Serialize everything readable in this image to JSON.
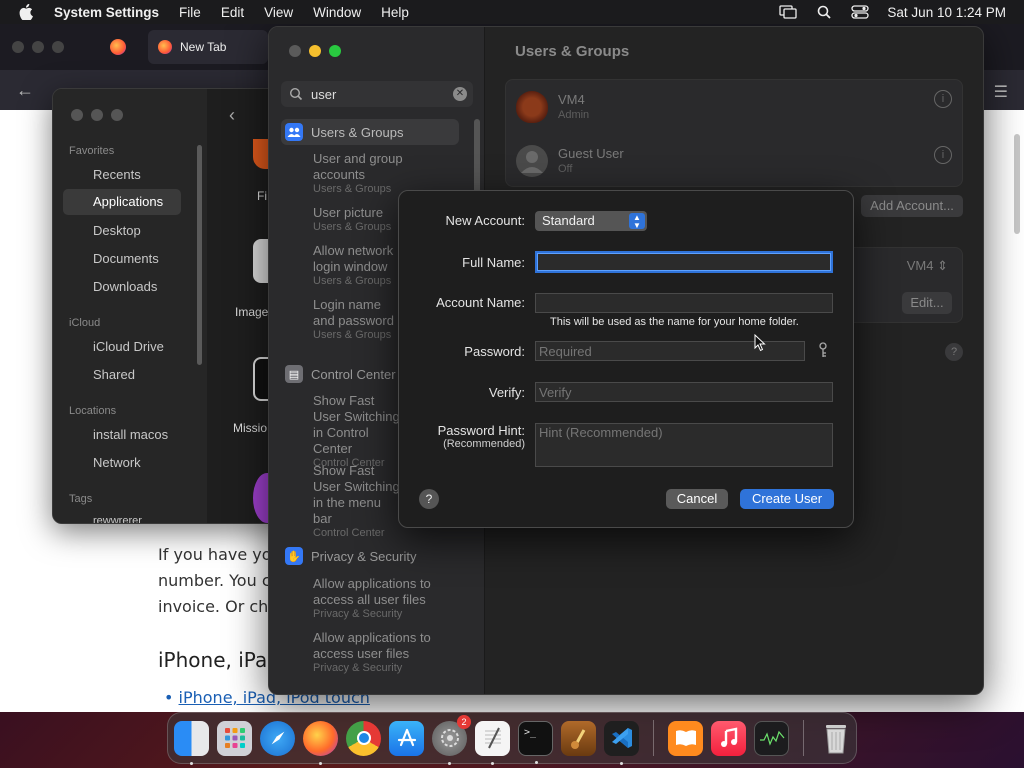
{
  "menubar": {
    "app_name": "System Settings",
    "menus": [
      "File",
      "Edit",
      "View",
      "Window",
      "Help"
    ],
    "clock": "Sat Jun 10  1:24 PM"
  },
  "browser": {
    "tab_title": "New Tab",
    "paragraph": "If you have you number. You c invoice. Or cho",
    "heading": "iPhone, iPad",
    "bullet_link": "iPhone, iPad, iPod touch"
  },
  "finder": {
    "favorites_label": "Favorites",
    "favorites": [
      "Recents",
      "Applications",
      "Desktop",
      "Documents",
      "Downloads"
    ],
    "icloud_label": "iCloud",
    "icloud": [
      "iCloud Drive",
      "Shared"
    ],
    "locations_label": "Locations",
    "locations": [
      "install macos",
      "Network"
    ],
    "tags_label": "Tags",
    "tag_item": "rewwrerer",
    "apps": [
      "Fi",
      "Image",
      "Missio"
    ]
  },
  "settings": {
    "search_value": "user",
    "categories": [
      {
        "label": "Users & Groups",
        "color": "#3478f6"
      },
      {
        "label": "Control Center",
        "color": "#6e6e73"
      },
      {
        "label": "Privacy & Security",
        "color": "#3478f6"
      }
    ],
    "results": [
      {
        "title": "User and group accounts",
        "sub": "Users & Groups"
      },
      {
        "title": "User picture",
        "sub": "Users & Groups"
      },
      {
        "title": "Allow network login window",
        "sub": "Users & Groups"
      },
      {
        "title": "Login name and password",
        "sub": "Users & Groups"
      },
      {
        "title": "Show Fast User Switching in Control Center",
        "sub": "Control Center"
      },
      {
        "title": "Show Fast User Switching in the menu bar",
        "sub": "Control Center"
      },
      {
        "title": "Allow applications to access all user files",
        "sub": "Privacy & Security"
      },
      {
        "title": "Allow applications to access user files",
        "sub": "Privacy & Security"
      }
    ],
    "pane_title": "Users & Groups",
    "users": [
      {
        "name": "VM4",
        "role": "Admin"
      },
      {
        "name": "Guest User",
        "role": "Off"
      }
    ],
    "add_account": "Add Account...",
    "auto_login_value": "VM4",
    "edit_button": "Edit..."
  },
  "sheet": {
    "new_account_label": "New Account:",
    "new_account_value": "Standard",
    "full_name_label": "Full Name:",
    "full_name_value": "",
    "account_name_label": "Account Name:",
    "account_name_value": "",
    "account_name_hint": "This will be used as the name for your home folder.",
    "password_label": "Password:",
    "password_placeholder": "Required",
    "verify_label": "Verify:",
    "verify_placeholder": "Verify",
    "hint_label": "Password Hint:",
    "hint_sublabel": "(Recommended)",
    "hint_placeholder": "Hint (Recommended)",
    "cancel": "Cancel",
    "create": "Create User"
  },
  "dock": {
    "apps": [
      "Finder",
      "Launchpad",
      "Safari",
      "Firefox",
      "Chrome",
      "App Store",
      "System Settings",
      "TextEdit",
      "Terminal",
      "Script Editor",
      "VS Code",
      "Books",
      "Music",
      "Activity Monitor",
      "Trash"
    ],
    "settings_badge": "2"
  },
  "colors": {
    "accent": "#2f73d9"
  }
}
